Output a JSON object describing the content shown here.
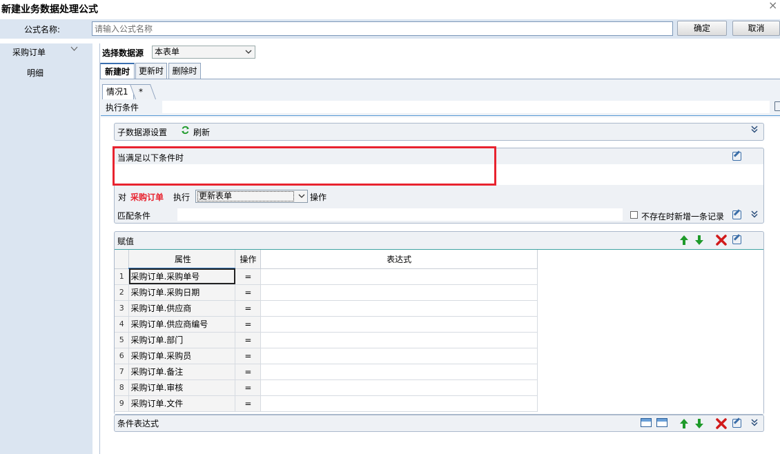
{
  "window": {
    "title": "新建业务数据处理公式",
    "close_glyph": "×"
  },
  "formula_name": {
    "label": "公式名称:",
    "placeholder": "请输入公式名称",
    "value": ""
  },
  "buttons": {
    "ok": "确定",
    "cancel": "取消"
  },
  "sidebar": {
    "items": [
      {
        "label": "采购订单",
        "icon": "chevron-down-icon"
      },
      {
        "label": "明细"
      }
    ]
  },
  "datasource": {
    "label": "选择数据源",
    "selected": "本表单"
  },
  "tabs": [
    {
      "label": "新建时",
      "active": true
    },
    {
      "label": "更新时",
      "active": false
    },
    {
      "label": "删除时",
      "active": false
    }
  ],
  "case_tabs": [
    {
      "label": "情况1"
    },
    {
      "label": "*"
    }
  ],
  "exec_condition": {
    "label": "执行条件",
    "value": ""
  },
  "sub_datasource": {
    "label": "子数据源设置",
    "refresh_label": "刷新",
    "refresh_icon": "refresh-icon"
  },
  "condition": {
    "header": "当满足以下条件时",
    "value": ""
  },
  "operation": {
    "prefix": "对",
    "target": "采购订单",
    "exec_label": "执行",
    "selected": "更新表单",
    "suffix": "操作",
    "match_label": "匹配条件",
    "match_value": "",
    "checkbox_label": "不存在时新增一条记录",
    "checkbox_checked": false
  },
  "assign": {
    "title": "赋值",
    "headers": {
      "attr": "属性",
      "op": "操作",
      "expr": "表达式"
    },
    "rows": [
      {
        "n": "1",
        "attr": "采购订单.采购单号",
        "op": "=",
        "expr": ""
      },
      {
        "n": "2",
        "attr": "采购订单.采购日期",
        "op": "=",
        "expr": ""
      },
      {
        "n": "3",
        "attr": "采购订单.供应商",
        "op": "=",
        "expr": ""
      },
      {
        "n": "4",
        "attr": "采购订单.供应商编号",
        "op": "=",
        "expr": ""
      },
      {
        "n": "5",
        "attr": "采购订单.部门",
        "op": "=",
        "expr": ""
      },
      {
        "n": "6",
        "attr": "采购订单.采购员",
        "op": "=",
        "expr": ""
      },
      {
        "n": "7",
        "attr": "采购订单.备注",
        "op": "=",
        "expr": ""
      },
      {
        "n": "8",
        "attr": "采购订单.审核",
        "op": "=",
        "expr": ""
      },
      {
        "n": "9",
        "attr": "采购订单.文件",
        "op": "=",
        "expr": ""
      }
    ]
  },
  "cond_expr": {
    "title": "条件表达式"
  },
  "colors": {
    "sidebar": "#dbe5f1",
    "highlight_box": "#e8232f",
    "accent": "#3b7fc4",
    "green_arrow": "#1e9a2a",
    "red_delete": "#d11a1a"
  },
  "glyphs": {
    "up": "🡅",
    "down": "🡇",
    "delete": "✖",
    "double_chevron": "︾",
    "chevron": "⌄",
    "refresh": "⟳"
  }
}
